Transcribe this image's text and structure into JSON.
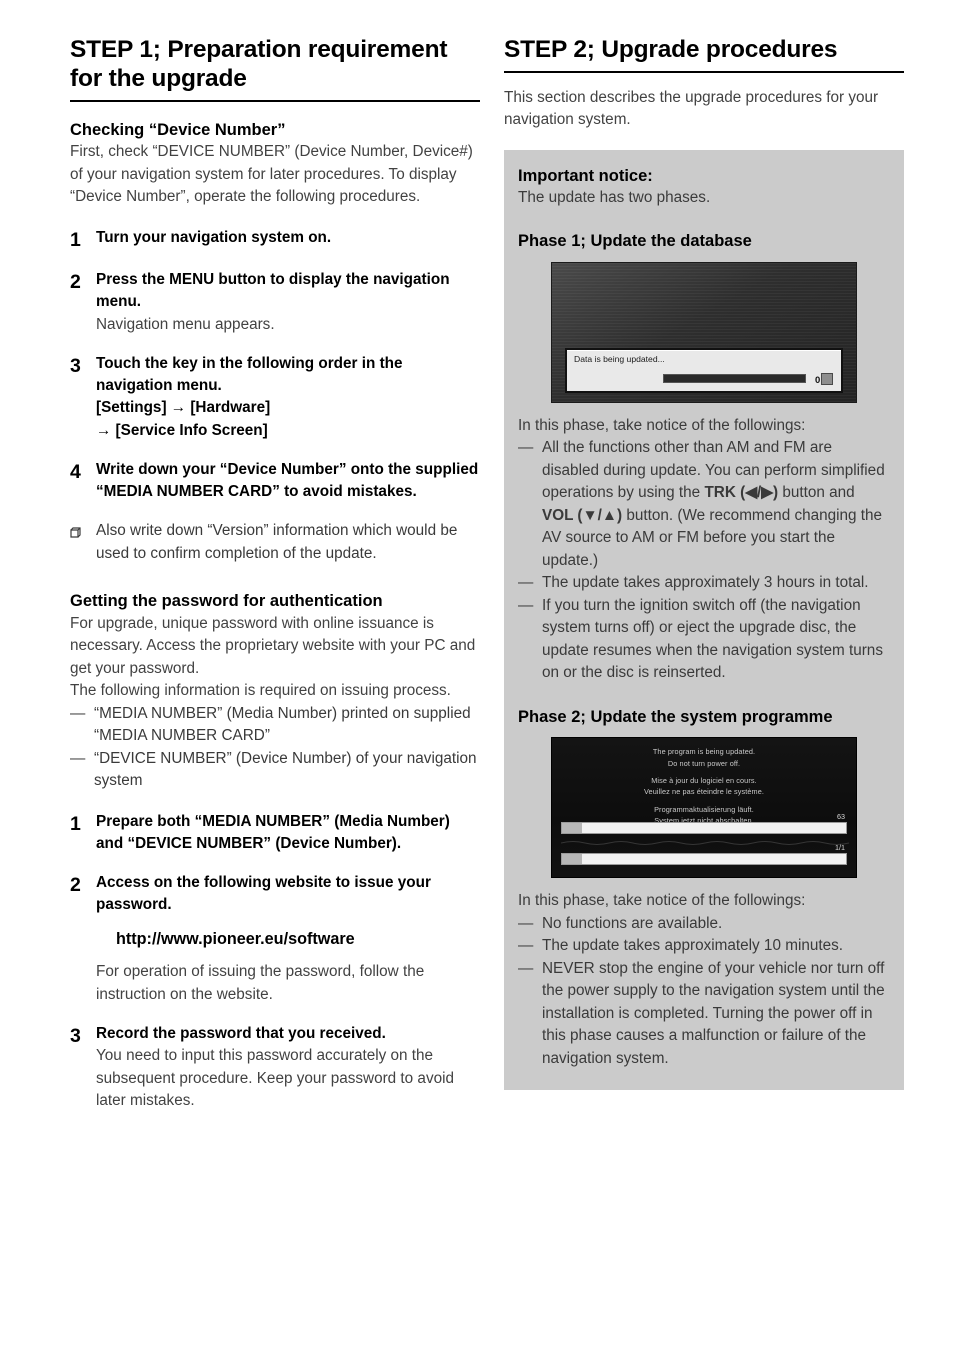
{
  "left": {
    "step_title": "STEP 1; Preparation requirement for the upgrade",
    "section1": {
      "heading": "Checking “Device Number”",
      "intro": "First, check “DEVICE NUMBER” (Device Number, Device#) of your navigation system for later procedures. To display “Device Number”, operate the following procedures.",
      "steps": [
        {
          "num": "1",
          "head": "Turn your navigation system on.",
          "note": ""
        },
        {
          "num": "2",
          "head": "Press the MENU button to display the navigation menu.",
          "note": "Navigation menu appears."
        },
        {
          "num": "3",
          "head": "Touch the key in the following order in the navigation menu.\n[Settings] → [Hardware]\n→ [Service Info Screen]",
          "note": ""
        },
        {
          "num": "4",
          "head": "Write down your “Device Number” onto the supplied “MEDIA NUMBER CARD” to avoid mistakes.",
          "note": ""
        }
      ],
      "square_note": "Also write down “Version” information which would be used to confirm completion of the update."
    },
    "section2": {
      "heading": "Getting the password for authentication",
      "intro": "For upgrade, unique password with online issuance is necessary. Access the proprietary website with your PC and get your password.\nThe following information is required on issuing process.",
      "dash_items": [
        "“MEDIA NUMBER” (Media Number) printed on supplied “MEDIA NUMBER CARD”",
        "“DEVICE NUMBER” (Device Number) of your navigation system"
      ],
      "steps": [
        {
          "num": "1",
          "head": "Prepare both “MEDIA NUMBER” (Media Number) and “DEVICE NUMBER” (Device Number).",
          "note": ""
        },
        {
          "num": "2",
          "head": "Access on the following website to issue your password.",
          "url": "http://www.pioneer.eu/software",
          "note": "For operation of issuing the password, follow the instruction on the website."
        },
        {
          "num": "3",
          "head": "Record the password that you received.",
          "note": "You need to input this password accurately on the subsequent procedure. Keep your password to avoid later mistakes."
        }
      ]
    }
  },
  "right": {
    "step_title": "STEP 2; Upgrade procedures",
    "intro": "This section describes the upgrade procedures for your navigation system.",
    "notice": {
      "heading": "Important notice:",
      "lead": "The update has two phases.",
      "phase1": {
        "heading": "Phase 1; Update the database",
        "screen": {
          "message": "Data is being updated...",
          "percent": "0 %"
        },
        "lead": "In this phase, take notice of the followings:",
        "items": [
          {
            "pre": "All the functions other than AM and FM are disabled during update. You can perform simplified operations by using the ",
            "bold1": "TRK (◀/▶)",
            "mid": " button and ",
            "bold2": "VOL (▼/▲)",
            "post": " button. (We recommend changing the AV source to AM or FM before you start the update.)"
          },
          {
            "pre": "The update takes approximately 3 hours in total.",
            "bold1": "",
            "mid": "",
            "bold2": "",
            "post": ""
          },
          {
            "pre": "If you turn the ignition switch off (the navigation system turns off) or eject the upgrade disc, the update resumes when the navigation system turns on or the disc is reinserted.",
            "bold1": "",
            "mid": "",
            "bold2": "",
            "post": ""
          }
        ]
      },
      "phase2": {
        "heading": "Phase 2; Update the system programme",
        "screen": {
          "line_en_1": "The program is being updated.",
          "line_en_2": "Do not turn power off.",
          "line_fr_1": "Mise à jour du logiciel en cours.",
          "line_fr_2": "Veuillez ne pas éteindre le système.",
          "line_de_1": "Programmaktualisierung läuft.",
          "line_de_2": "System jetzt nicht abschalten.",
          "bar1_label": "63",
          "bar2_label": "1/1"
        },
        "lead": "In this phase, take notice of the followings:",
        "items": [
          "No functions are available.",
          "The update takes approximately 10 minutes.",
          "NEVER stop the engine of your vehicle nor turn off the power supply to the navigation system until the installation is completed. Turning the power off in this phase causes a malfunction or failure of the navigation system."
        ]
      }
    }
  },
  "colors": {
    "notice_bg": "#cbcbcb",
    "text": "#424242",
    "heading": "#000000"
  }
}
